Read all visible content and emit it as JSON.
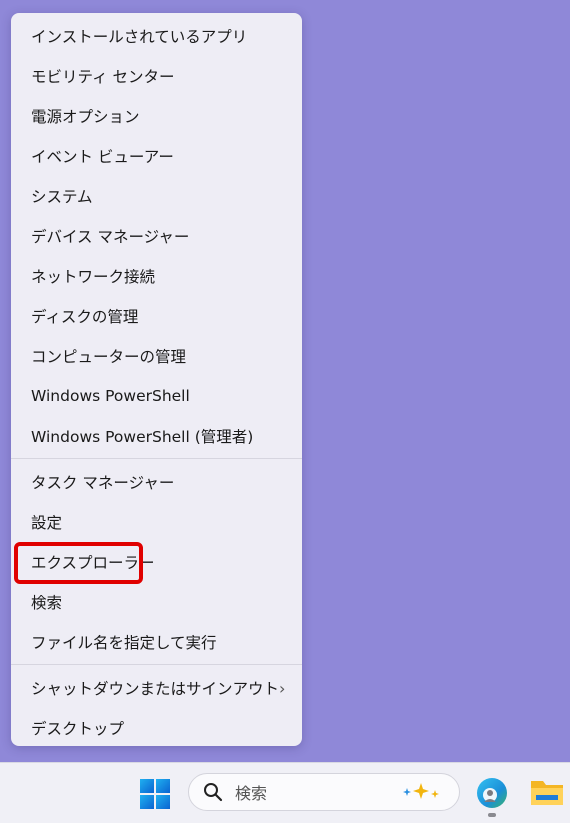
{
  "menu": {
    "items": [
      {
        "label": "インストールされているアプリ"
      },
      {
        "label": "モビリティ センター"
      },
      {
        "label": "電源オプション"
      },
      {
        "label": "イベント ビューアー"
      },
      {
        "label": "システム"
      },
      {
        "label": "デバイス マネージャー"
      },
      {
        "label": "ネットワーク接続"
      },
      {
        "label": "ディスクの管理"
      },
      {
        "label": "コンピューターの管理"
      },
      {
        "label": "Windows PowerShell"
      },
      {
        "label": "Windows PowerShell (管理者)"
      },
      {
        "label": "タスク マネージャー"
      },
      {
        "label": "設定"
      },
      {
        "label": "エクスプローラー"
      },
      {
        "label": "検索"
      },
      {
        "label": "ファイル名を指定して実行"
      },
      {
        "label": "シャットダウンまたはサインアウト",
        "chevron": "›"
      },
      {
        "label": "デスクトップ"
      }
    ]
  },
  "taskbar": {
    "search_placeholder": "検索",
    "icons": [
      "windows-start-icon",
      "search-icon",
      "copilot-sparkle-icon",
      "edge-icon",
      "file-explorer-icon"
    ]
  },
  "colors": {
    "desktop": "#8f88d8",
    "menu_bg": "#eeedf5",
    "highlight": "#e00000"
  }
}
